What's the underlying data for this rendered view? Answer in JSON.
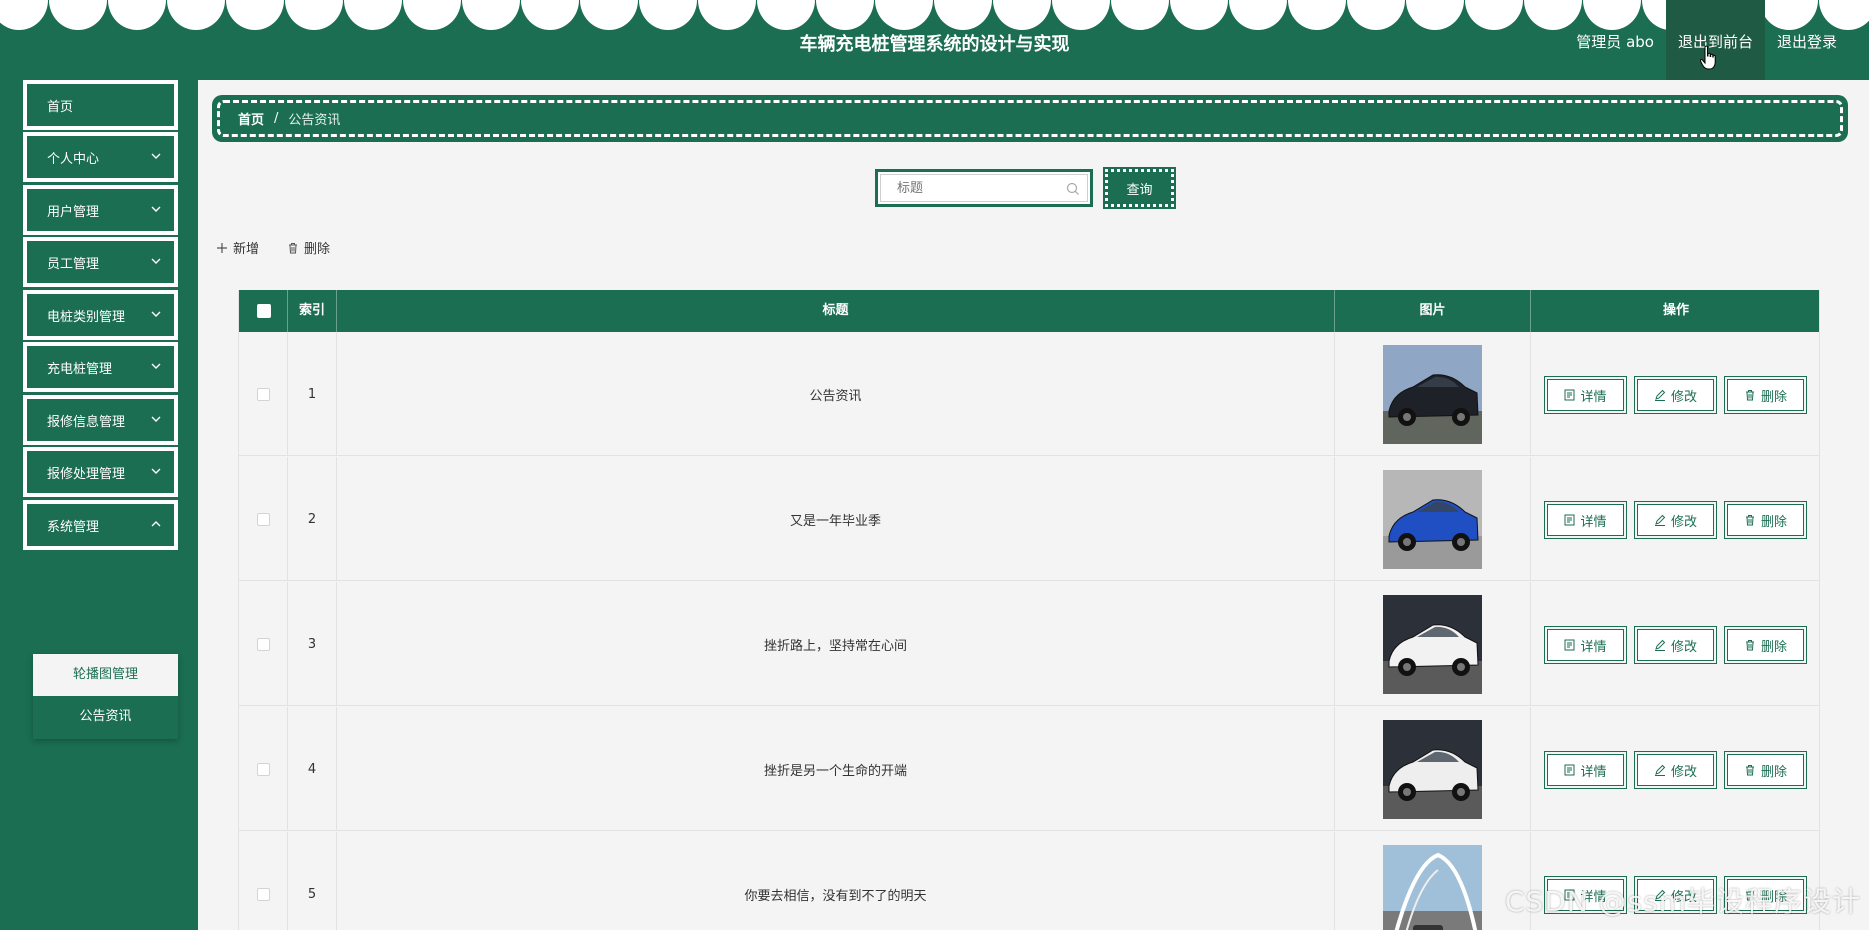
{
  "header": {
    "title": "车辆充电桩管理系统的设计与实现",
    "user": "管理员 abo",
    "to_front": "退出到前台",
    "logout": "退出登录",
    "bg_color": "#1b6e52"
  },
  "sidebar": {
    "items": [
      {
        "label": "首页"
      },
      {
        "label": "个人中心"
      },
      {
        "label": "用户管理"
      },
      {
        "label": "员工管理"
      },
      {
        "label": "电桩类别管理"
      },
      {
        "label": "充电桩管理"
      },
      {
        "label": "报修信息管理"
      },
      {
        "label": "报修处理管理"
      },
      {
        "label": "系统管理"
      }
    ],
    "sub_items": [
      {
        "label": "轮播图管理"
      },
      {
        "label": "公告资讯"
      }
    ]
  },
  "breadcrumb": {
    "home": "首页",
    "sep": "/",
    "current": "公告资讯"
  },
  "search": {
    "placeholder": "标题",
    "query_label": "查询"
  },
  "actions": {
    "add": "新增",
    "delete": "删除"
  },
  "table": {
    "headers": {
      "index": "索引",
      "title": "标题",
      "image": "图片",
      "ops": "操作"
    },
    "rows": [
      {
        "index": "1",
        "title": "公告资讯"
      },
      {
        "index": "2",
        "title": "又是一年毕业季"
      },
      {
        "index": "3",
        "title": "挫折路上，坚持常在心间"
      },
      {
        "index": "4",
        "title": "挫折是另一个生命的开端"
      },
      {
        "index": "5",
        "title": "你要去相信，没有到不了的明天"
      }
    ],
    "row_buttons": {
      "detail": "详情",
      "edit": "修改",
      "delete": "删除"
    }
  },
  "watermark": "CSDN @ssm毕设程序设计"
}
